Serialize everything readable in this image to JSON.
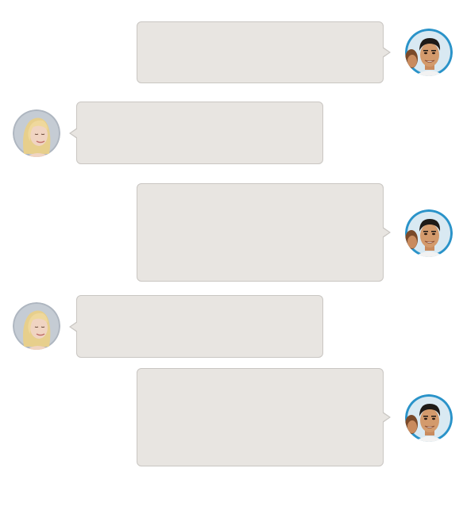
{
  "avatars": {
    "male": {
      "icon": "male-user-avatar",
      "ring_color": "#2a93c9"
    },
    "female": {
      "icon": "female-user-avatar",
      "ring_color": "#aeb6c0"
    }
  },
  "messages": [
    {
      "sender": "male",
      "direction": "outgoing",
      "text": ""
    },
    {
      "sender": "female",
      "direction": "incoming",
      "text": ""
    },
    {
      "sender": "male",
      "direction": "outgoing",
      "text": ""
    },
    {
      "sender": "female",
      "direction": "incoming",
      "text": ""
    },
    {
      "sender": "male",
      "direction": "outgoing",
      "text": ""
    }
  ],
  "colors": {
    "bubble_fill": "#e8e5e1",
    "bubble_border": "#c9c6c2",
    "background": "#ffffff"
  }
}
